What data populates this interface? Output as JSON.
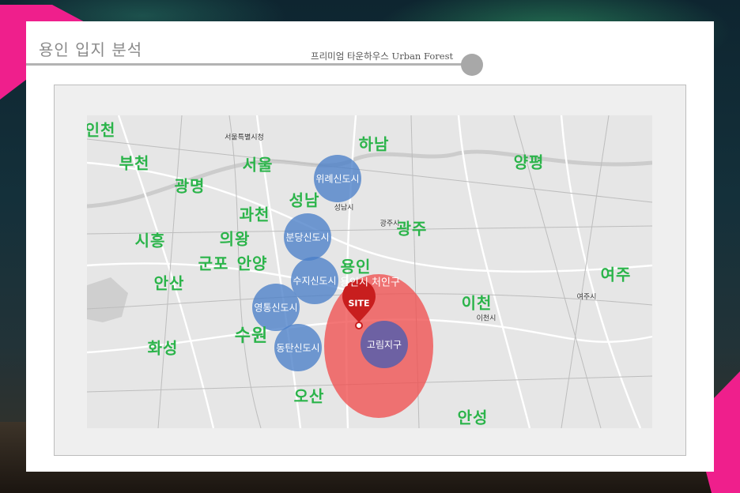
{
  "header": {
    "title": "용인 입지 분석",
    "subtitle": "프리미엄 타운하우스 Urban Forest"
  },
  "map": {
    "regions": [
      {
        "key": "incheon",
        "label": "인천"
      },
      {
        "key": "bucheon",
        "label": "부천"
      },
      {
        "key": "gwangmyeong",
        "label": "광명"
      },
      {
        "key": "seoul",
        "label": "서울"
      },
      {
        "key": "hanam",
        "label": "하남"
      },
      {
        "key": "yangpyeong",
        "label": "양평"
      },
      {
        "key": "seongnam",
        "label": "성남"
      },
      {
        "key": "gwacheon",
        "label": "과천"
      },
      {
        "key": "siheung",
        "label": "시흥"
      },
      {
        "key": "uiwang",
        "label": "의왕"
      },
      {
        "key": "gunpo",
        "label": "군포"
      },
      {
        "key": "anyang",
        "label": "안양"
      },
      {
        "key": "ansan",
        "label": "안산"
      },
      {
        "key": "gwangju",
        "label": "광주"
      },
      {
        "key": "yongin",
        "label": "용인"
      },
      {
        "key": "yeoju",
        "label": "여주"
      },
      {
        "key": "icheon",
        "label": "이천"
      },
      {
        "key": "suwon",
        "label": "수원"
      },
      {
        "key": "hwaseong",
        "label": "화성"
      },
      {
        "key": "osan",
        "label": "오산"
      },
      {
        "key": "anseong",
        "label": "안성"
      }
    ],
    "new_towns": [
      {
        "key": "wirye",
        "label": "위례신도시"
      },
      {
        "key": "bundang",
        "label": "분당신도시"
      },
      {
        "key": "suji",
        "label": "수지신도시"
      },
      {
        "key": "yeongtong",
        "label": "영통신도시"
      },
      {
        "key": "dongtan",
        "label": "동탄신도시"
      },
      {
        "key": "gorim",
        "label": "고림지구"
      }
    ],
    "site": {
      "marker_label": "SITE",
      "area_label": "용인시 처인구"
    },
    "base_labels": {
      "seoul_city": "서울특별시청",
      "gwangju_city": "광주시",
      "icheon_city": "이천시",
      "yeoju_city": "여주시",
      "seongnam_city": "성남시"
    },
    "colors": {
      "region_label": "#2bb44a",
      "new_town_fill": "#4a7fc8",
      "site_zone_fill": "#f0504f",
      "site_marker": "#c81e1e",
      "gorim_fill": "#5e5fa8"
    }
  }
}
